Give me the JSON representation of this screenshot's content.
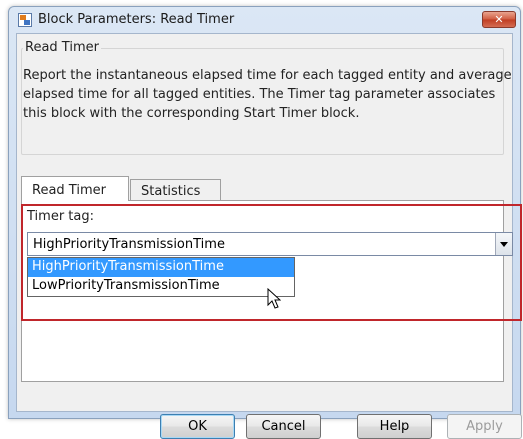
{
  "window": {
    "title": "Block Parameters: Read Timer",
    "close_label": "✕"
  },
  "block": {
    "group_title": "Read Timer",
    "description": "Report the instantaneous elapsed time for each tagged entity and average elapsed time for all tagged entities. The Timer tag parameter associates this block with the corresponding Start Timer block."
  },
  "tabs": [
    {
      "label": "Read Timer",
      "active": true
    },
    {
      "label": "Statistics",
      "active": false
    }
  ],
  "parameters": {
    "timer_tag": {
      "label": "Timer tag:",
      "value": "HighPriorityTransmissionTime",
      "options": [
        {
          "label": "HighPriorityTransmissionTime",
          "highlighted": true
        },
        {
          "label": "LowPriorityTransmissionTime",
          "highlighted": false
        }
      ]
    }
  },
  "buttons": {
    "ok": "OK",
    "cancel": "Cancel",
    "help": "Help",
    "apply": "Apply"
  },
  "colors": {
    "highlight_border": "#c0262b",
    "selection": "#3399ff"
  }
}
